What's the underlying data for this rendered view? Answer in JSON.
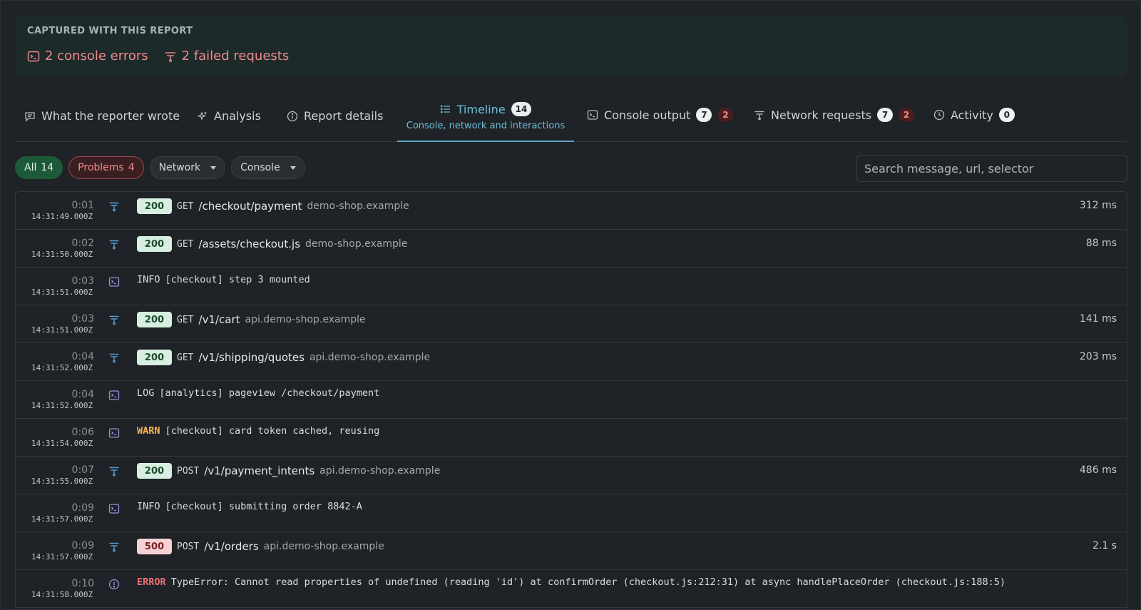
{
  "banner": {
    "title": "CAPTURED WITH THIS REPORT",
    "console_errors": "2 console errors",
    "failed_requests": "2 failed requests"
  },
  "tabs": {
    "reporter": "What the reporter wrote",
    "analysis": "Analysis",
    "details": "Report details",
    "timeline": {
      "label": "Timeline",
      "count": "14",
      "subtitle": "Console, network and interactions"
    },
    "console": {
      "label": "Console output",
      "count": "7",
      "errors": "2"
    },
    "network": {
      "label": "Network requests",
      "count": "7",
      "errors": "2"
    },
    "activity": {
      "label": "Activity",
      "count": "0"
    }
  },
  "filters": {
    "all_label": "All",
    "all_count": "14",
    "problems_label": "Problems",
    "problems_count": "4",
    "network": "Network",
    "console": "Console",
    "search_placeholder": "Search message, url, selector"
  },
  "rows": [
    {
      "rel": "0:01",
      "abs": "14:31:49.000Z",
      "type": "net",
      "status": "200",
      "method": "GET",
      "path": "/checkout/payment",
      "host": "demo-shop.example",
      "dur": "312 ms"
    },
    {
      "rel": "0:02",
      "abs": "14:31:50.000Z",
      "type": "net",
      "status": "200",
      "method": "GET",
      "path": "/assets/checkout.js",
      "host": "demo-shop.example",
      "dur": "88 ms"
    },
    {
      "rel": "0:03",
      "abs": "14:31:51.000Z",
      "type": "console",
      "level": "INFO",
      "message": "[checkout] step 3 mounted"
    },
    {
      "rel": "0:03",
      "abs": "14:31:51.000Z",
      "type": "net",
      "status": "200",
      "method": "GET",
      "path": "/v1/cart",
      "host": "api.demo-shop.example",
      "dur": "141 ms"
    },
    {
      "rel": "0:04",
      "abs": "14:31:52.000Z",
      "type": "net",
      "status": "200",
      "method": "GET",
      "path": "/v1/shipping/quotes",
      "host": "api.demo-shop.example",
      "dur": "203 ms"
    },
    {
      "rel": "0:04",
      "abs": "14:31:52.000Z",
      "type": "console",
      "level": "LOG",
      "message": "[analytics] pageview /checkout/payment"
    },
    {
      "rel": "0:06",
      "abs": "14:31:54.000Z",
      "type": "console",
      "level": "WARN",
      "message": "[checkout] card token cached, reusing"
    },
    {
      "rel": "0:07",
      "abs": "14:31:55.000Z",
      "type": "net",
      "status": "200",
      "method": "POST",
      "path": "/v1/payment_intents",
      "host": "api.demo-shop.example",
      "dur": "486 ms"
    },
    {
      "rel": "0:09",
      "abs": "14:31:57.000Z",
      "type": "console",
      "level": "INFO",
      "message": "[checkout] submitting order 8842-A"
    },
    {
      "rel": "0:09",
      "abs": "14:31:57.000Z",
      "type": "net",
      "status": "500",
      "method": "POST",
      "path": "/v1/orders",
      "host": "api.demo-shop.example",
      "dur": "2.1 s"
    },
    {
      "rel": "0:10",
      "abs": "14:31:58.000Z",
      "type": "error",
      "level": "ERROR",
      "message": "TypeError: Cannot read properties of undefined (reading 'id') at confirmOrder (checkout.js:212:31) at async handlePlaceOrder (checkout.js:188:5)"
    }
  ]
}
